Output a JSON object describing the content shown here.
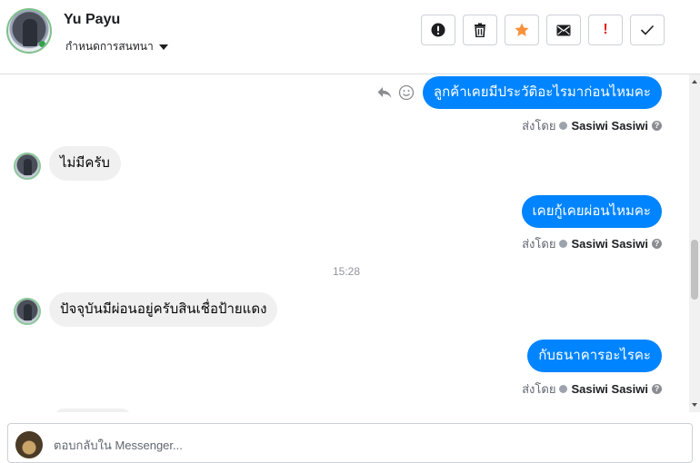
{
  "header": {
    "contact_name": "Yu Payu",
    "subtitle": "กำหนดการสนทนา",
    "toolbar": [
      {
        "name": "report-button",
        "icon": "exclamation-circle-icon"
      },
      {
        "name": "delete-button",
        "icon": "trash-icon"
      },
      {
        "name": "star-button",
        "icon": "star-icon"
      },
      {
        "name": "mark-unread-button",
        "icon": "envelope-icon"
      },
      {
        "name": "important-button",
        "icon": "exclamation-icon",
        "label": "!"
      },
      {
        "name": "done-button",
        "icon": "checkmark-icon"
      }
    ]
  },
  "messages": [
    {
      "direction": "out",
      "text": "ลูกค้าเคยมีประวัติอะไรมาก่อนไหมคะ",
      "sent_prefix": "ส่งโดย",
      "sender": "Sasiwi Sasiwi",
      "help": "?"
    },
    {
      "direction": "in",
      "text": "ไม่มีครับ"
    },
    {
      "direction": "out",
      "text": "เคยกู้เคยผ่อนไหมคะ",
      "sent_prefix": "ส่งโดย",
      "sender": "Sasiwi Sasiwi",
      "help": "?"
    },
    {
      "direction": "divider",
      "text": "15:28"
    },
    {
      "direction": "in",
      "text": "ปัจจุบันมีผ่อนอยู่ครับสินเชื่อป้ายแดง"
    },
    {
      "direction": "out",
      "text": "กับธนาคารอะไรคะ",
      "sent_prefix": "ส่งโดย",
      "sender": "Sasiwi Sasiwi",
      "help": "?"
    }
  ],
  "composer": {
    "placeholder": "ตอบกลับใน Messenger..."
  },
  "colors": {
    "outgoing_bubble": "#0084ff",
    "incoming_bubble": "#f0f0f0",
    "star": "#f7923b",
    "important": "#e02020"
  }
}
